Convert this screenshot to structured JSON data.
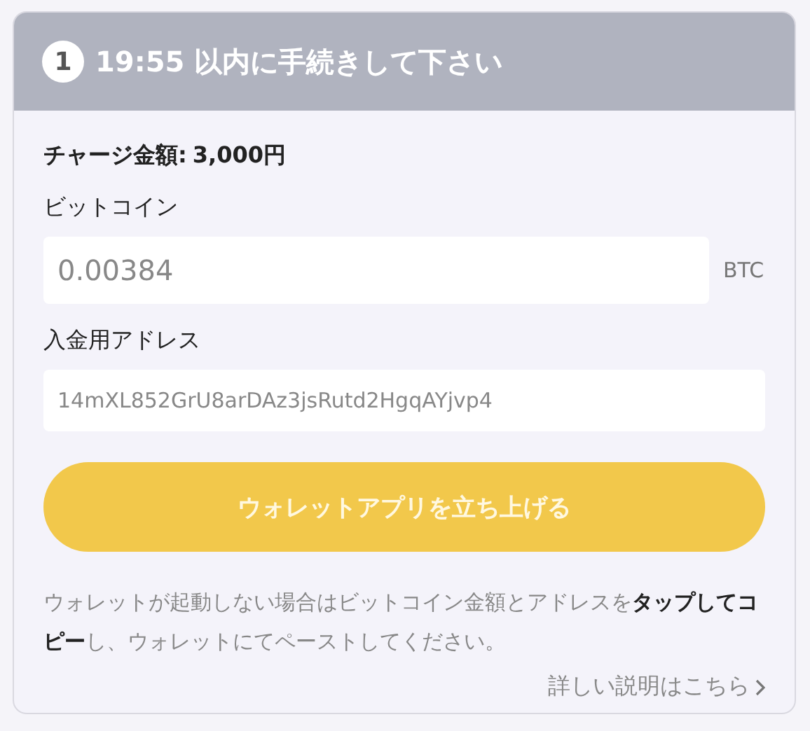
{
  "header": {
    "step": "1",
    "title": "19:55 以内に手続きして下さい"
  },
  "charge": {
    "label": "チャージ金額:",
    "amount": "3,000円"
  },
  "bitcoin": {
    "label": "ビットコイン",
    "value": "0.00384",
    "unit": "BTC"
  },
  "address": {
    "label": "入金用アドレス",
    "value": "14mXL852GrU8arDAz3jsRutd2HgqAYjvp4"
  },
  "button": "ウォレットアプリを立ち上げる",
  "note": "ウォレットが起動しない場合はビットコイン金額とアドレスを**タップしてコピー**し、ウォレットにてペーストしてください。",
  "link": "詳しい説明はこちら"
}
